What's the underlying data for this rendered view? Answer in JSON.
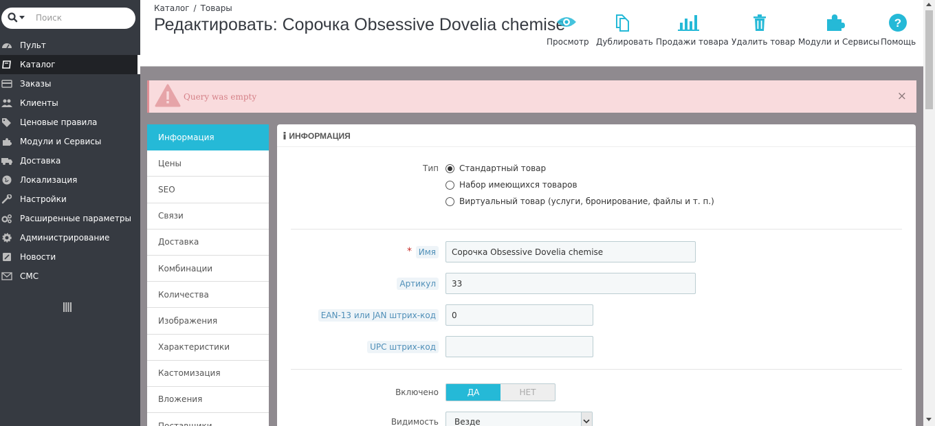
{
  "search": {
    "placeholder": "Поиск",
    "icon": "search-icon"
  },
  "sidebar": {
    "items": [
      {
        "label": "Пульт",
        "icon": "dashboard-icon"
      },
      {
        "label": "Каталог",
        "icon": "book-icon",
        "active": true
      },
      {
        "label": "Заказы",
        "icon": "credit-card-icon"
      },
      {
        "label": "Клиенты",
        "icon": "users-icon"
      },
      {
        "label": "Ценовые правила",
        "icon": "tags-icon"
      },
      {
        "label": "Модули и Сервисы",
        "icon": "puzzle-icon"
      },
      {
        "label": "Доставка",
        "icon": "truck-icon"
      },
      {
        "label": "Локализация",
        "icon": "globe-icon"
      },
      {
        "label": "Настройки",
        "icon": "wrench-icon"
      },
      {
        "label": "Расширенные параметры",
        "icon": "cogs-icon"
      },
      {
        "label": "Администрирование",
        "icon": "gear-icon"
      },
      {
        "label": "Новости",
        "icon": "news-icon"
      },
      {
        "label": "СМС",
        "icon": "envelope-icon"
      }
    ]
  },
  "header": {
    "breadcrumb": [
      "Каталог",
      "Товары"
    ],
    "title": "Редактировать: Сорочка Obsessive Dovelia chemise",
    "toolbar": [
      {
        "label": "Просмотр",
        "icon": "eye-icon"
      },
      {
        "label": "Дублировать",
        "icon": "copy-icon"
      },
      {
        "label": "Продажи товара",
        "icon": "bar-chart-icon"
      },
      {
        "label": "Удалить товар",
        "icon": "trash-icon"
      },
      {
        "label": "Модули и Сервисы",
        "icon": "puzzle-icon"
      },
      {
        "label": "Помощь",
        "icon": "help-icon"
      }
    ]
  },
  "alert": {
    "text": "Query was empty",
    "close": "×"
  },
  "tabs": [
    "Информация",
    "Цены",
    "SEO",
    "Связи",
    "Доставка",
    "Комбинации",
    "Количества",
    "Изображения",
    "Характеристики",
    "Кастомизация",
    "Вложения",
    "Поставщики"
  ],
  "panel": {
    "heading": "ИНФОРМАЦИЯ",
    "type_label": "Тип",
    "type_options": [
      "Стандартный товар",
      "Набор имеющихся товаров",
      "Виртуальный товар (услуги, бронирование, файлы и т. п.)"
    ],
    "type_selected": 0,
    "name_label": "Имя",
    "name_value": "Сорочка Obsessive Dovelia chemise",
    "sku_label": "Артикул",
    "sku_value": "33",
    "ean_label": "EAN-13 или JAN штрих-код",
    "ean_value": "0",
    "upc_label": "UPC штрих-код",
    "upc_value": "",
    "enabled_label": "Включено",
    "enabled_yes": "ДА",
    "enabled_no": "НЕТ",
    "enabled_value": "ДА",
    "visibility_label": "Видимость",
    "visibility_value": "Везде"
  },
  "colors": {
    "accent": "#25b9d7",
    "sidebar": "#363a41",
    "alert_bg": "#f9dbdd",
    "alert_text": "#d58188"
  }
}
